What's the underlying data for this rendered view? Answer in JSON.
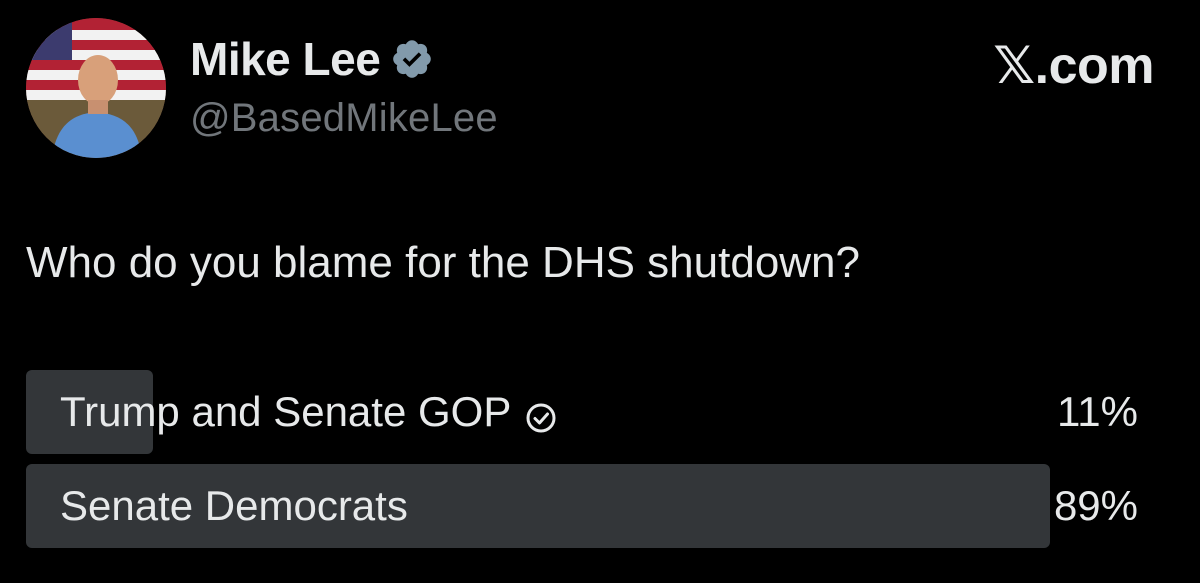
{
  "post": {
    "author": {
      "display_name": "Mike Lee",
      "handle": "@BasedMikeLee",
      "verified_icon": "verified-badge-icon"
    },
    "brand": "𝕏.com",
    "question": "Who do you blame for the DHS shutdown?"
  },
  "poll": {
    "options": [
      {
        "label": "Trump and Senate GOP",
        "percent_label": "11%",
        "percent": 11,
        "selected": true
      },
      {
        "label": "Senate Democrats",
        "percent_label": "89%",
        "percent": 89,
        "selected": false
      }
    ]
  },
  "colors": {
    "background": "#000000",
    "text_primary": "#e7e9ea",
    "text_secondary": "#71767b",
    "poll_fill": "#333639"
  }
}
